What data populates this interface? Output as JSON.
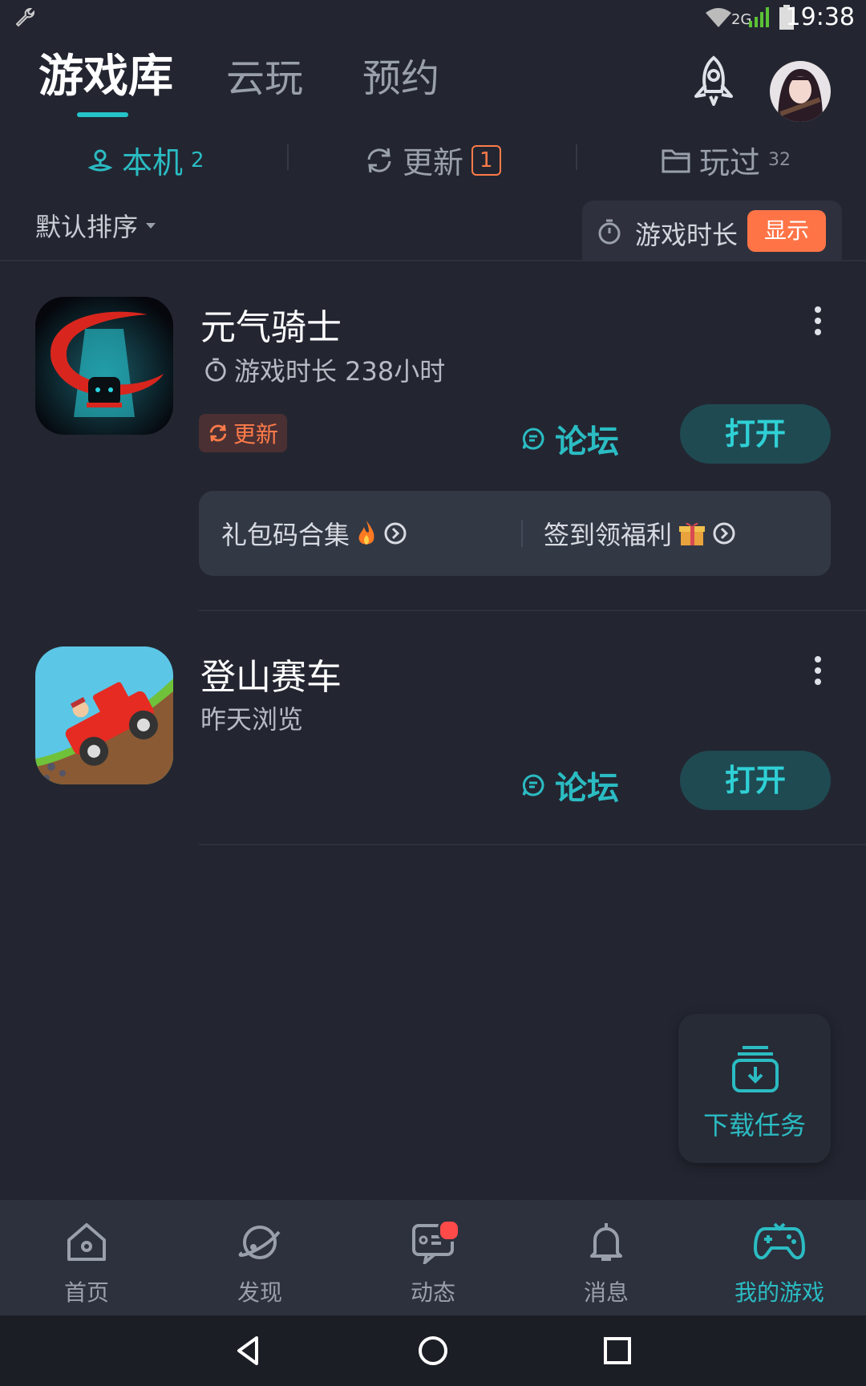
{
  "status": {
    "time": "19:38",
    "network": "2G"
  },
  "top_tabs": {
    "library": "游戏库",
    "cloud": "云玩",
    "reserve": "预约"
  },
  "sub_tabs": {
    "local": {
      "label": "本机",
      "count": "2"
    },
    "update": {
      "label": "更新",
      "count": "1"
    },
    "played": {
      "label": "玩过",
      "count": "32"
    }
  },
  "sort": {
    "label": "默认排序"
  },
  "playtime_toggle": {
    "label": "游戏时长",
    "button": "显示"
  },
  "games": [
    {
      "title": "元气骑士",
      "subtitle": "游戏时长 238小时",
      "update_tag": "更新",
      "forum": "论坛",
      "open": "打开",
      "gift_code": "礼包码合集",
      "signin": "签到领福利"
    },
    {
      "title": "登山赛车",
      "subtitle": "昨天浏览",
      "forum": "论坛",
      "open": "打开"
    }
  ],
  "download_card": {
    "label": "下载任务"
  },
  "bottom_nav": [
    "首页",
    "发现",
    "动态",
    "消息",
    "我的游戏"
  ],
  "colors": {
    "accent": "#2bbcc3",
    "orange": "#ff7447",
    "background": "#232631"
  }
}
